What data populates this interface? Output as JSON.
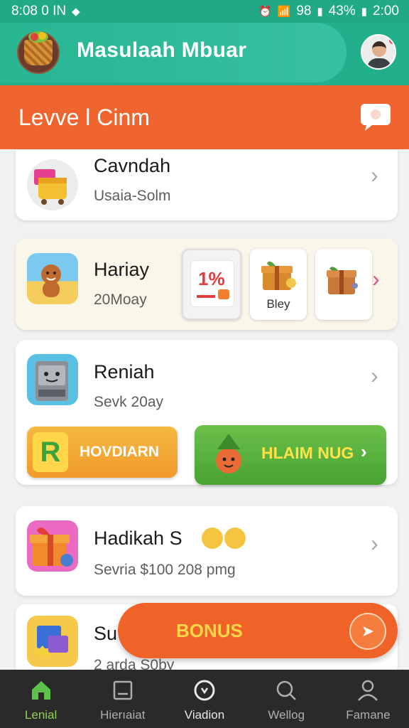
{
  "status_bar": {
    "left_text": "8:08 0 IN",
    "network": "98",
    "battery": "43%",
    "time": "2:00"
  },
  "app": {
    "title": "Masulaah Mbuar"
  },
  "banner": {
    "title": "Levve l Cinm"
  },
  "cards": [
    {
      "title": "Cavndah",
      "subtitle": "Usaia-Solm"
    },
    {
      "title": "Hariay",
      "subtitle": "20Moay",
      "offers": [
        {
          "label": "1%"
        },
        {
          "label": "Bley"
        },
        {
          "label": ""
        }
      ]
    },
    {
      "title": "Reniah",
      "subtitle": "Sevk 20ay",
      "left_button": "HOVDIARN",
      "right_button": "HLAIM NUG"
    },
    {
      "title": "Hadikah S",
      "subtitle": "Sevria $100 208 pmg"
    },
    {
      "title": "Su",
      "subtitle": "2 arda S0by"
    }
  ],
  "bonus": {
    "label": "BONUS"
  },
  "nav": [
    {
      "label": "Lenial",
      "icon": "home-icon",
      "active": true
    },
    {
      "label": "Hierıaiat",
      "icon": "square-icon",
      "active": false
    },
    {
      "label": "Viadion",
      "icon": "clock-icon",
      "active": false
    },
    {
      "label": "Wellog",
      "icon": "search-icon",
      "active": false
    },
    {
      "label": "Famane",
      "icon": "person-icon",
      "active": false
    }
  ],
  "colors": {
    "accent": "#22b08c",
    "banner": "#f0652f",
    "active_nav": "#8fd14f"
  }
}
